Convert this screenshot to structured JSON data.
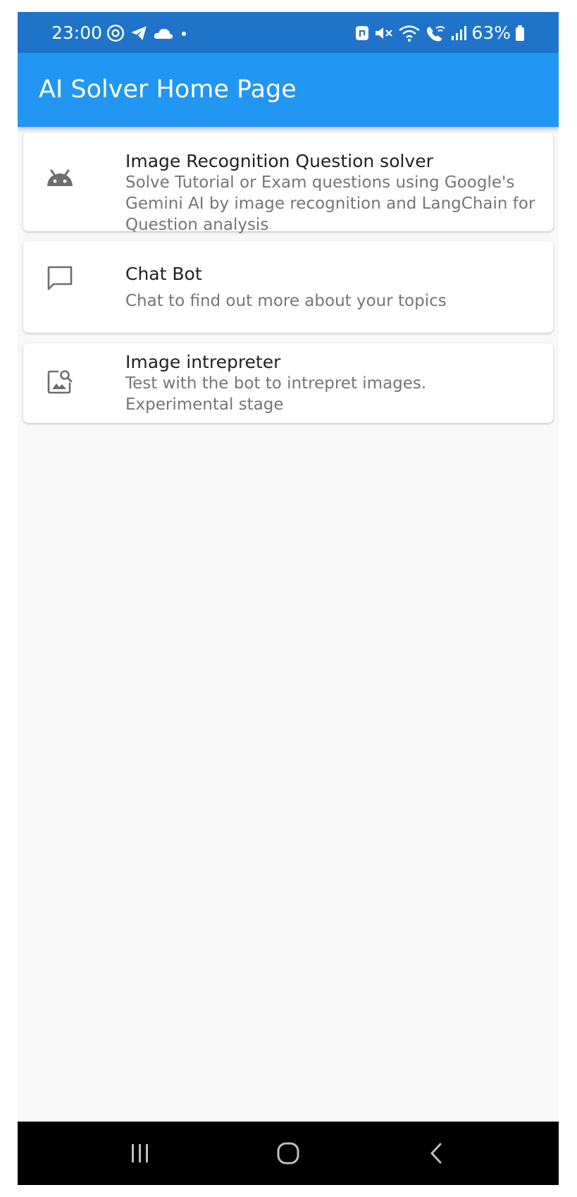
{
  "status_bar": {
    "time": "23:00",
    "battery": "63%",
    "left_icons": [
      "threads-icon",
      "telegram-icon",
      "cloud-icon",
      "dot-icon"
    ],
    "right_icons": [
      "nfc-icon",
      "mute-icon",
      "wifi-icon",
      "wifi-call-icon",
      "signal-icon",
      "battery-icon"
    ]
  },
  "app_bar": {
    "title": "AI Solver Home Page",
    "color": "#2196f3"
  },
  "menu": [
    {
      "icon": "android-icon",
      "title": "Image Recognition Question solver",
      "subtitle": "Solve Tutorial or Exam questions using Google's Gemini AI by image recognition and LangChain for Question analysis"
    },
    {
      "icon": "chat-bubble-icon",
      "title": "Chat Bot",
      "subtitle": "Chat to find out more about your topics"
    },
    {
      "icon": "image-search-icon",
      "title": "Image intrepreter",
      "subtitle": "Test with the bot to intrepret images. Experimental stage"
    }
  ],
  "nav_bar": {
    "buttons": [
      "recent-apps-icon",
      "home-icon",
      "back-icon"
    ]
  }
}
